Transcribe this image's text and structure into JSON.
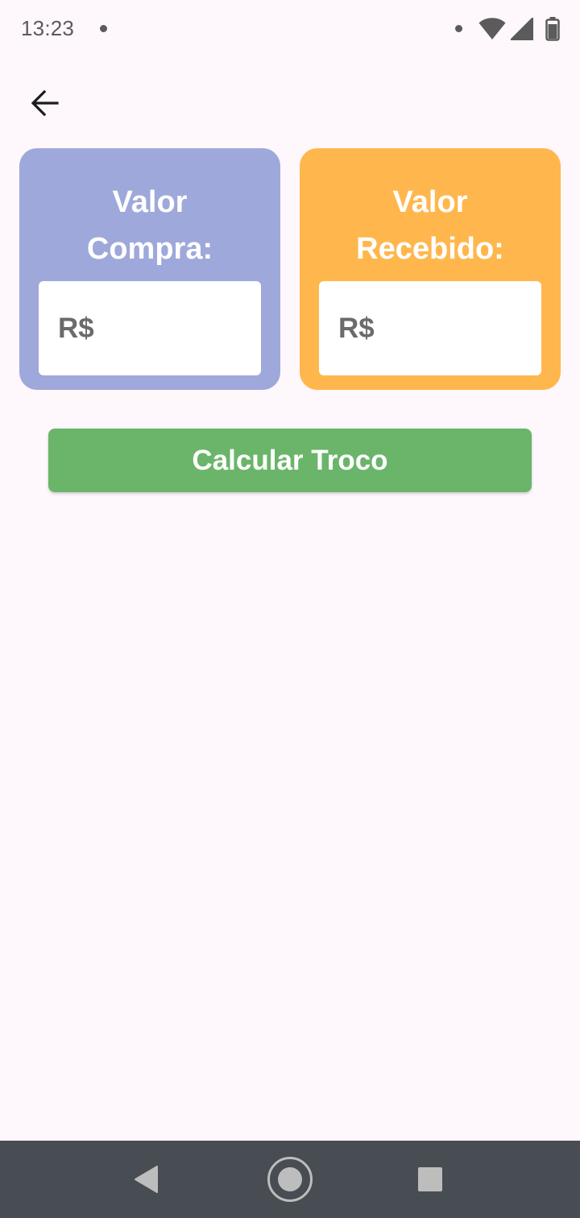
{
  "status_bar": {
    "time": "13:23"
  },
  "icons": {
    "back": "arrow-left-icon",
    "wifi": "wifi-icon",
    "signal": "cell-signal-icon",
    "battery": "battery-icon",
    "nav_back": "triangle-back-icon",
    "nav_home": "circle-home-icon",
    "nav_recents": "square-recents-icon"
  },
  "cards": {
    "compra": {
      "title": "Valor\nCompra:",
      "input_prefix": "R$",
      "color": "#9FA8DA"
    },
    "recebido": {
      "title": "Valor\nRecebido:",
      "input_prefix": "R$",
      "color": "#FFB74D"
    }
  },
  "actions": {
    "calculate_label": "Calcular Troco",
    "calculate_color": "#6AB56A"
  },
  "colors": {
    "background": "#FEF7FB",
    "nav_bar": "#474D52"
  }
}
